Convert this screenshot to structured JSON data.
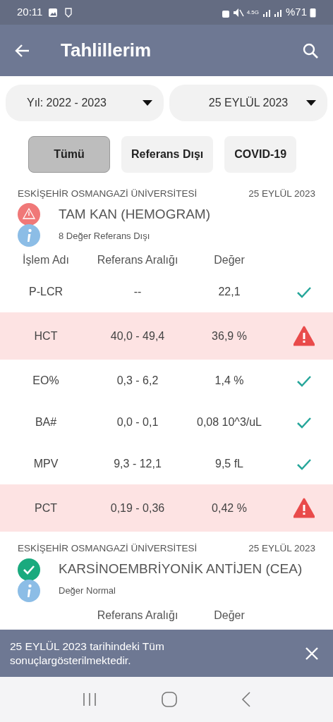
{
  "status_bar": {
    "time": "20:11",
    "network": "4.5G",
    "battery": "%71"
  },
  "app_bar": {
    "title": "Tahlillerim"
  },
  "filters": {
    "year": "Yıl: 2022 - 2023",
    "date": "25 EYLÜL 2023"
  },
  "chips": [
    {
      "label": "Tümü",
      "selected": true
    },
    {
      "label": "Referans Dışı",
      "selected": false
    },
    {
      "label": "COVID-19",
      "selected": false
    }
  ],
  "groups": [
    {
      "institution": "ESKİŞEHİR OSMANGAZİ ÜNİVERSİTESİ",
      "date": "25 EYLÜL 2023",
      "test": "TAM KAN (HEMOGRAM)",
      "abnormal": true,
      "summary": "8 Değer Referans Dışı",
      "columns": [
        "İşlem Adı",
        "Referans Aralığı",
        "Değer"
      ],
      "rows": [
        {
          "name": "P-LCR",
          "range": "--",
          "value": "22,1",
          "abnormal": false
        },
        {
          "name": "HCT",
          "range": "40,0 - 49,4",
          "value": "36,9 %",
          "abnormal": true
        },
        {
          "name": "EO%",
          "range": "0,3 - 6,2",
          "value": "1,4 %",
          "abnormal": false
        },
        {
          "name": "BA#",
          "range": "0,0 - 0,1",
          "value": "0,08 10^3/uL",
          "abnormal": false
        },
        {
          "name": "MPV",
          "range": "9,3 - 12,1",
          "value": "9,5 fL",
          "abnormal": false
        },
        {
          "name": "PCT",
          "range": "0,19 - 0,36",
          "value": "0,42 %",
          "abnormal": true
        }
      ]
    },
    {
      "institution": "ESKİŞEHİR OSMANGAZİ ÜNİVERSİTESİ",
      "date": "25 EYLÜL 2023",
      "test": "KARSİNOEMBRİYONİK ANTİJEN (CEA)",
      "abnormal": false,
      "summary": "Değer Normal",
      "columns": [
        null,
        "Referans Aralığı",
        "Değer"
      ]
    }
  ],
  "snackbar": {
    "message": "25 EYLÜL 2023 tarihindeki Tüm sonuçlargösterilmektedir."
  }
}
